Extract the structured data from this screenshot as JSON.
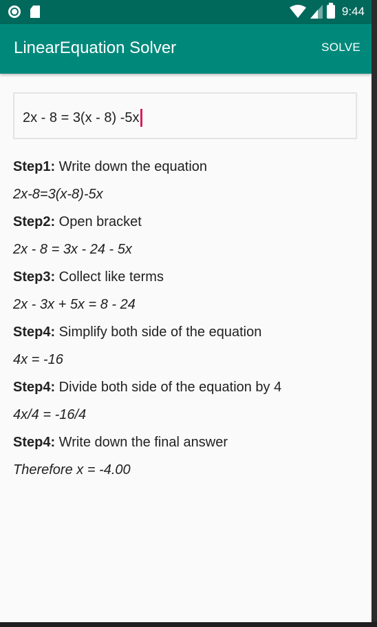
{
  "status_bar": {
    "time": "9:44",
    "icons": [
      "notification-circle-icon",
      "sd-card-icon",
      "wifi-icon",
      "cellular-signal-icon",
      "battery-icon"
    ]
  },
  "app_bar": {
    "title": "LinearEquation Solver",
    "solve_label": "SOLVE"
  },
  "input": {
    "value": "2x - 8 = 3(x - 8) -5x"
  },
  "steps": [
    {
      "label": "Step1:",
      "text": " Write down the equation",
      "equation": "2x-8=3(x-8)-5x"
    },
    {
      "label": "Step2:",
      "text": " Open bracket",
      "equation": "2x - 8 = 3x - 24 - 5x"
    },
    {
      "label": "Step3:",
      "text": " Collect like terms",
      "equation": "2x - 3x + 5x = 8 - 24"
    },
    {
      "label": "Step4:",
      "text": " Simplify both side of the equation",
      "equation": "4x = -16"
    },
    {
      "label": "Step4:",
      "text": " Divide both side of the equation by 4",
      "equation": "4x/4 = -16/4"
    },
    {
      "label": "Step4:",
      "text": " Write down the final answer",
      "equation": "Therefore x = -4.00"
    }
  ],
  "colors": {
    "status_bar": "#00695c",
    "app_bar": "#00897b",
    "caret": "#d81b60",
    "background": "#fafafa"
  }
}
